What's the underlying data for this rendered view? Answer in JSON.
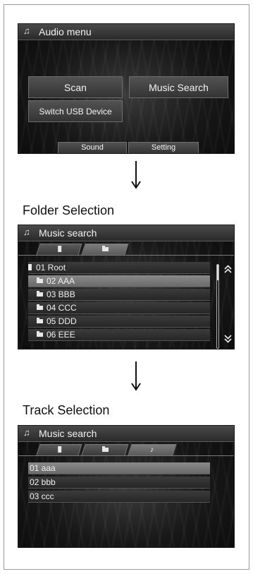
{
  "screen1": {
    "title": "Audio menu",
    "buttons": {
      "scan": "Scan",
      "music_search": "Music Search",
      "switch_usb": "Switch USB Device"
    },
    "bottom": {
      "sound": "Sound",
      "setting": "Setting"
    }
  },
  "heading_folder": "Folder Selection",
  "screen2": {
    "title": "Music search",
    "root": "01 Root",
    "folders": [
      "02 AAA",
      "03 BBB",
      "04 CCC",
      "05 DDD",
      "06 EEE"
    ]
  },
  "heading_track": "Track Selection",
  "screen3": {
    "title": "Music search",
    "tracks": [
      "01 aaa",
      "02 bbb",
      "03 ccc"
    ]
  },
  "icons": {
    "music_note": "music-note-icon",
    "folder": "folder-icon",
    "usb": "usb-icon",
    "scroll_up": "chevron-double-up-icon",
    "scroll_down": "chevron-double-down-icon"
  },
  "colors": {
    "screen_bg": "#171717",
    "selected_row": "#7a7a7a",
    "text": "#f0f0f0"
  }
}
